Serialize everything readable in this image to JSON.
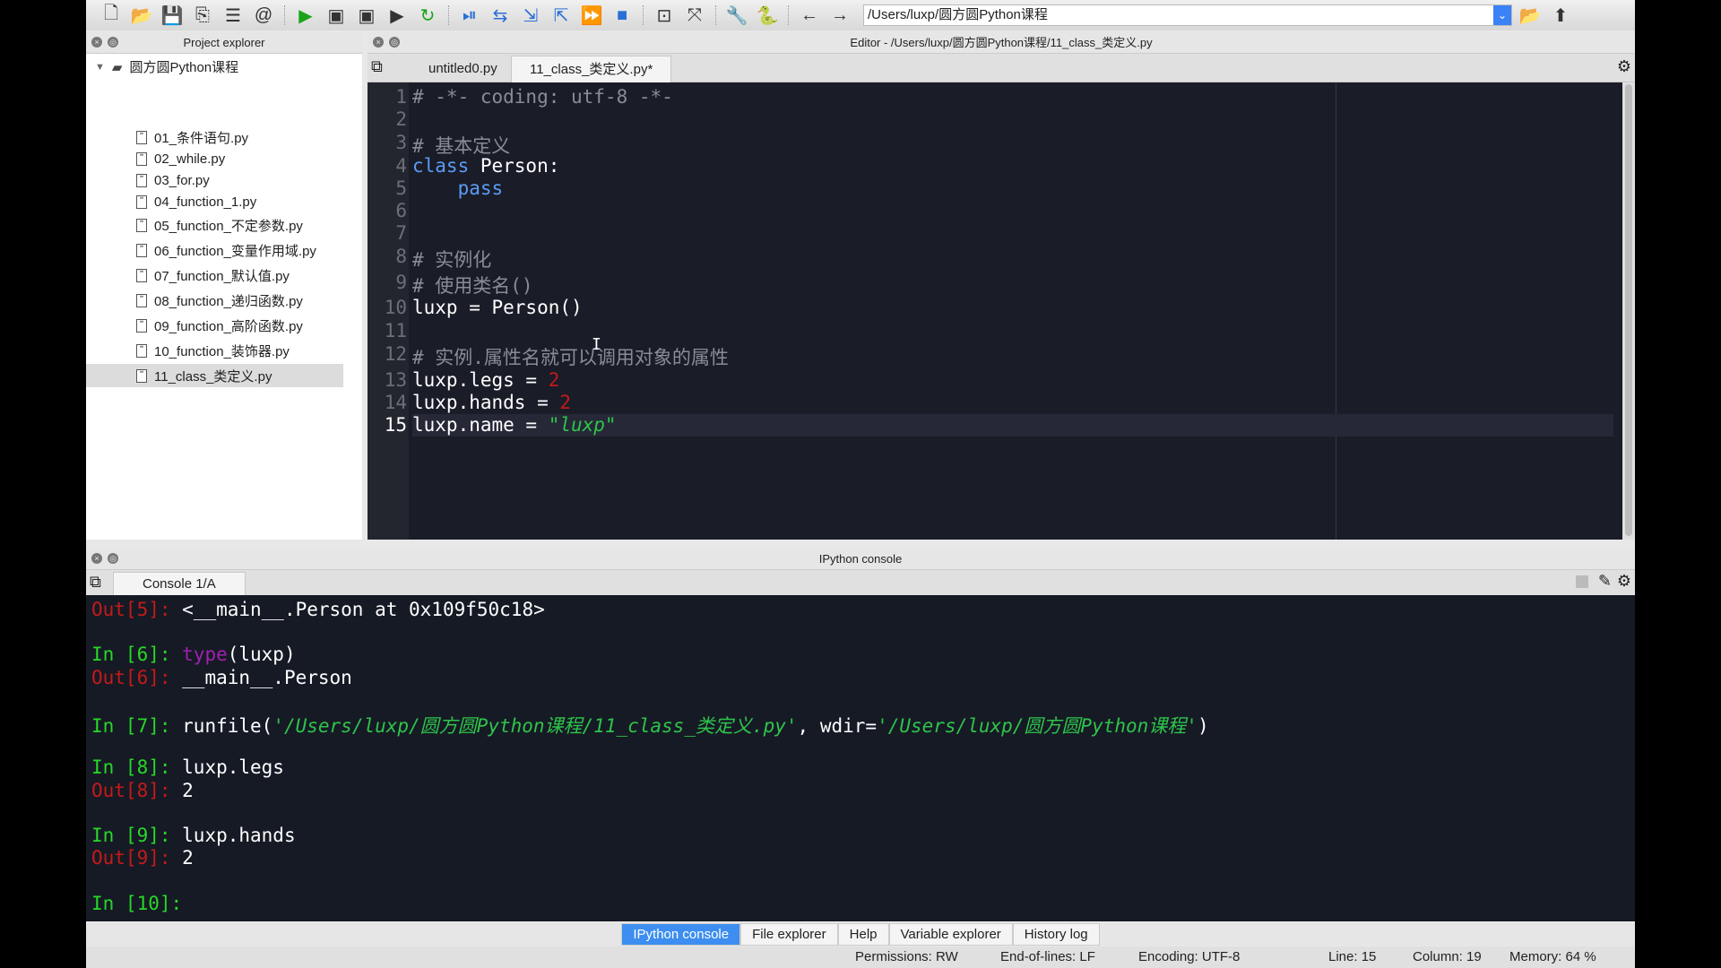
{
  "toolbar": {
    "icons": [
      "new-file-icon",
      "open-folder-icon",
      "save-icon",
      "save-all-icon",
      "outline-icon",
      "at-icon",
      "run-icon",
      "run-cell-icon",
      "run-cell-advance-icon",
      "run-selection-icon",
      "rerun-icon",
      "debug-icon",
      "step-icon",
      "step-into-icon",
      "step-return-icon",
      "continue-icon",
      "stop-icon",
      "maximize-pane-icon",
      "fullscreen-icon",
      "wrench-icon",
      "python-icon",
      "back-arrow-icon",
      "forward-arrow-icon"
    ],
    "path": "/Users/luxp/圆方圆Python课程"
  },
  "project_explorer": {
    "title": "Project explorer",
    "root": "圆方圆Python课程",
    "files": [
      "01_条件语句.py",
      "02_while.py",
      "03_for.py",
      "04_function_1.py",
      "05_function_不定参数.py",
      "06_function_变量作用域.py",
      "07_function_默认值.py",
      "08_function_递归函数.py",
      "09_function_高阶函数.py",
      "10_function_装饰器.py",
      "11_class_类定义.py"
    ],
    "selected": "11_class_类定义.py"
  },
  "editor": {
    "title": "Editor - /Users/luxp/圆方圆Python课程/11_class_类定义.py",
    "tabs": [
      "untitled0.py",
      "11_class_类定义.py*"
    ],
    "active_tab": 1,
    "current_line": 15,
    "lines": [
      [
        {
          "t": "# -*- coding: utf-8 -*-",
          "c": "comment"
        }
      ],
      [],
      [
        {
          "t": "# 基本定义",
          "c": "comment"
        }
      ],
      [
        {
          "t": "class",
          "c": "keyword"
        },
        {
          "t": " Person:",
          "c": "plain"
        }
      ],
      [
        {
          "t": "    pass",
          "c": "keyword"
        }
      ],
      [],
      [],
      [
        {
          "t": "# 实例化",
          "c": "comment"
        }
      ],
      [
        {
          "t": "# 使用类名()",
          "c": "comment"
        }
      ],
      [
        {
          "t": "luxp = Person()",
          "c": "plain"
        }
      ],
      [],
      [
        {
          "t": "# 实例.属性名就可以调用对象的属性",
          "c": "comment"
        }
      ],
      [
        {
          "t": "luxp.legs = ",
          "c": "plain"
        },
        {
          "t": "2",
          "c": "number"
        }
      ],
      [
        {
          "t": "luxp.hands = ",
          "c": "plain"
        },
        {
          "t": "2",
          "c": "number"
        }
      ],
      [
        {
          "t": "luxp.name = ",
          "c": "plain"
        },
        {
          "t": "\"luxp\"",
          "c": "string"
        }
      ]
    ]
  },
  "console": {
    "title": "IPython console",
    "tab": "Console 1/A",
    "lines": [
      [
        {
          "t": "Out[5]: ",
          "c": "out"
        },
        {
          "t": "<__main__.Person at 0x109f50c18>",
          "c": "plain"
        }
      ],
      [],
      [
        {
          "t": "In [6]: ",
          "c": "in"
        },
        {
          "t": "type",
          "c": "builtin"
        },
        {
          "t": "(luxp)",
          "c": "plain"
        }
      ],
      [
        {
          "t": "Out[6]: ",
          "c": "out"
        },
        {
          "t": "__main__.Person",
          "c": "plain"
        }
      ],
      [],
      [
        {
          "t": "In [7]: ",
          "c": "in"
        },
        {
          "t": "runfile(",
          "c": "plain"
        },
        {
          "t": "'/Users/luxp/圆方圆Python课程/11_class_类定义.py'",
          "c": "str"
        },
        {
          "t": ", wdir=",
          "c": "plain"
        },
        {
          "t": "'/Users/luxp/圆方圆Python课程'",
          "c": "str"
        },
        {
          "t": ")",
          "c": "plain"
        }
      ],
      [],
      [
        {
          "t": "In [8]: ",
          "c": "in"
        },
        {
          "t": "luxp.legs",
          "c": "plain"
        }
      ],
      [
        {
          "t": "Out[8]: ",
          "c": "out"
        },
        {
          "t": "2",
          "c": "plain"
        }
      ],
      [],
      [
        {
          "t": "In [9]: ",
          "c": "in"
        },
        {
          "t": "luxp.hands",
          "c": "plain"
        }
      ],
      [
        {
          "t": "Out[9]: ",
          "c": "out"
        },
        {
          "t": "2",
          "c": "plain"
        }
      ],
      [],
      [
        {
          "t": "In [10]: ",
          "c": "in"
        }
      ]
    ]
  },
  "bottom_tabs": [
    "IPython console",
    "File explorer",
    "Help",
    "Variable explorer",
    "History log"
  ],
  "status": {
    "permissions": "Permissions:  RW",
    "eol": "End-of-lines:  LF",
    "encoding": "Encoding:  UTF-8",
    "line": "Line:  15",
    "column": "Column:  19",
    "memory": "Memory:   64 %"
  },
  "colors": {
    "comment": "#8a8c95",
    "keyword": "#5b9cf5",
    "plain": "#ffffff",
    "number": "#c41a1a",
    "string": "#2ec44a",
    "in": "#27d827",
    "out": "#c41a1a",
    "builtin": "#a020b0",
    "str": "#2ec44a",
    "accent": "#3d8ef0"
  }
}
